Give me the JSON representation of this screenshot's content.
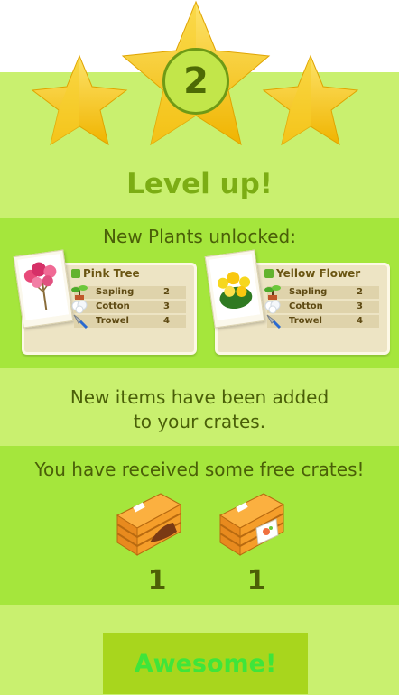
{
  "level": {
    "number": "2",
    "title": "Level up!"
  },
  "unlocks": {
    "heading": "New Plants unlocked:",
    "plants": [
      {
        "name": "Pink Tree",
        "requirements": [
          {
            "item": "Sapling",
            "qty": "2"
          },
          {
            "item": "Cotton",
            "qty": "3"
          },
          {
            "item": "Trowel",
            "qty": "4"
          }
        ]
      },
      {
        "name": "Yellow Flower",
        "requirements": [
          {
            "item": "Sapling",
            "qty": "2"
          },
          {
            "item": "Cotton",
            "qty": "3"
          },
          {
            "item": "Trowel",
            "qty": "4"
          }
        ]
      }
    ]
  },
  "items_message": {
    "line1": "New items have been added",
    "line2": "to your crates."
  },
  "crates": {
    "heading": "You have received some free crates!",
    "list": [
      {
        "icon": "soil-crate-icon",
        "count": "1"
      },
      {
        "icon": "seed-packet-crate-icon",
        "count": "1"
      }
    ]
  },
  "button": {
    "label": "Awesome!"
  },
  "colors": {
    "panel": "#c9f06f",
    "band": "#a5e63c",
    "title": "#7cad14",
    "star": "#f5c518",
    "button_bg": "#a8d61d",
    "button_text": "#3fe53a"
  }
}
